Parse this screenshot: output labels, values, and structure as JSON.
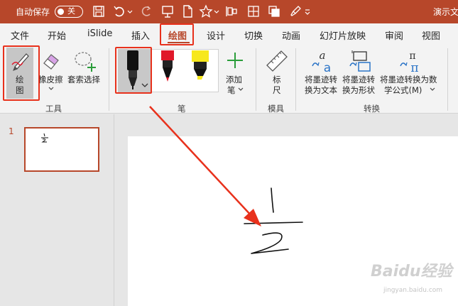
{
  "titlebar": {
    "autosave_label": "自动保存",
    "autosave_state": "关",
    "doc_title": "演示文"
  },
  "tabs": [
    {
      "label": "文件"
    },
    {
      "label": "开始"
    },
    {
      "label": "iSlide"
    },
    {
      "label": "插入"
    },
    {
      "label": "绘图",
      "active": true
    },
    {
      "label": "设计"
    },
    {
      "label": "切换"
    },
    {
      "label": "动画"
    },
    {
      "label": "幻灯片放映"
    },
    {
      "label": "审阅"
    },
    {
      "label": "视图"
    }
  ],
  "ribbon": {
    "tools": {
      "draw_line1": "绘",
      "draw_line2": "图",
      "eraser": "橡皮擦",
      "lasso": "套索选择",
      "group_label": "工具"
    },
    "pens": {
      "add_pen_line1": "添加",
      "add_pen_line2": "笔",
      "group_label": "笔",
      "pen_colors": [
        "#111111",
        "#e0182a",
        "#f7e81c"
      ]
    },
    "stencils": {
      "ruler_line1": "标",
      "ruler_line2": "尺",
      "group_label": "模具"
    },
    "convert": {
      "ink_to_text_line1": "将墨迹转",
      "ink_to_text_line2": "换为文本",
      "ink_to_shape_line1": "将墨迹转",
      "ink_to_shape_line2": "换为形状",
      "ink_to_math_line1": "将墨迹转换为数",
      "ink_to_math_line2": "学公式(M)",
      "group_label": "转换"
    }
  },
  "thumbs": {
    "slide_number": "1"
  },
  "watermark": {
    "main": "Baidu经验",
    "sub": "jingyan.baidu.com"
  },
  "colors": {
    "accent": "#b7472a",
    "highlight": "#e8311c"
  }
}
